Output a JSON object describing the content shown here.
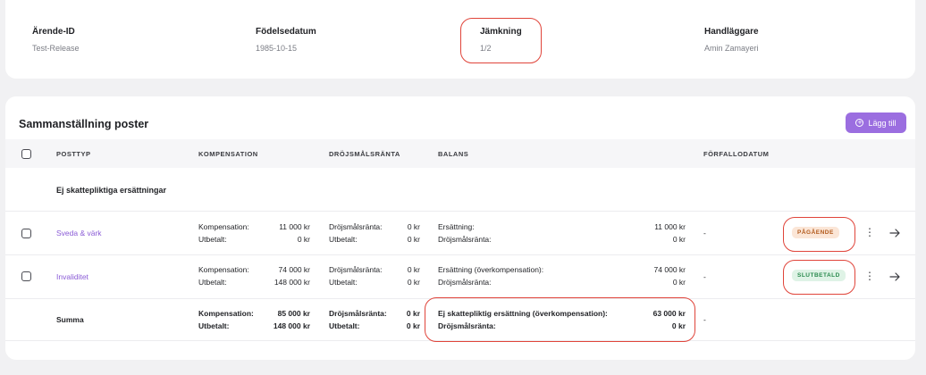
{
  "info": {
    "arende_id": {
      "label": "Ärende-ID",
      "value": "Test-Release"
    },
    "fodelsedatum": {
      "label": "Födelsedatum",
      "value": "1985-10-15"
    },
    "jamkning": {
      "label": "Jämkning",
      "value": "1/2"
    },
    "handlaggare": {
      "label": "Handläggare",
      "value": "Amin Zamayeri"
    }
  },
  "section": {
    "title": "Sammanställning poster",
    "add_button": "Lägg till"
  },
  "table": {
    "headers": {
      "posttyp": "POSTTYP",
      "kompensation": "KOMPENSATION",
      "drojsmalsranta": "DRÖJSMÅLSRÄNTA",
      "balans": "BALANS",
      "forfallodatum": "FÖRFALLODATUM"
    },
    "group_title": "Ej skattepliktiga ersättningar",
    "rows": [
      {
        "name": "Sveda & värk",
        "komp_label": "Kompensation:",
        "komp_value": "11 000 kr",
        "utb_label": "Utbetalt:",
        "utb_value": "0 kr",
        "dr_label": "Dröjsmålsränta:",
        "dr_value": "0 kr",
        "dr_utb_label": "Utbetalt:",
        "dr_utb_value": "0 kr",
        "bal_label": "Ersättning:",
        "bal_value": "11 000 kr",
        "bal_dr_label": "Dröjsmålsränta:",
        "bal_dr_value": "0 kr",
        "due": "-",
        "status": "PÅGÅENDE"
      },
      {
        "name": "Invaliditet",
        "komp_label": "Kompensation:",
        "komp_value": "74 000 kr",
        "utb_label": "Utbetalt:",
        "utb_value": "148 000 kr",
        "dr_label": "Dröjsmålsränta:",
        "dr_value": "0 kr",
        "dr_utb_label": "Utbetalt:",
        "dr_utb_value": "0 kr",
        "bal_label": "Ersättning (överkompensation):",
        "bal_value": "74 000 kr",
        "bal_dr_label": "Dröjsmålsränta:",
        "bal_dr_value": "0 kr",
        "due": "-",
        "status": "SLUTBETALD"
      }
    ],
    "summary": {
      "label": "Summa",
      "komp_label": "Kompensation:",
      "komp_value": "85 000 kr",
      "utb_label": "Utbetalt:",
      "utb_value": "148 000 kr",
      "dr_label": "Dröjsmålsränta:",
      "dr_value": "0 kr",
      "dr_utb_label": "Utbetalt:",
      "dr_utb_value": "0 kr",
      "bal_label": "Ej skattepliktig ersättning (överkompensation):",
      "bal_value": "63 000 kr",
      "bal_dr_label": "Dröjsmålsränta:",
      "bal_dr_value": "0 kr",
      "due": "-"
    }
  },
  "colors": {
    "accent": "#9b6ee0",
    "link": "#8a5bd6",
    "highlight_ring": "#e0443a",
    "badge_pagaende": "#fbe6d7",
    "badge_slutbetald": "#dff3e6"
  },
  "icons": [
    "plus-circle-icon",
    "kebab-menu-icon",
    "arrow-right-icon",
    "checkbox-icon"
  ]
}
